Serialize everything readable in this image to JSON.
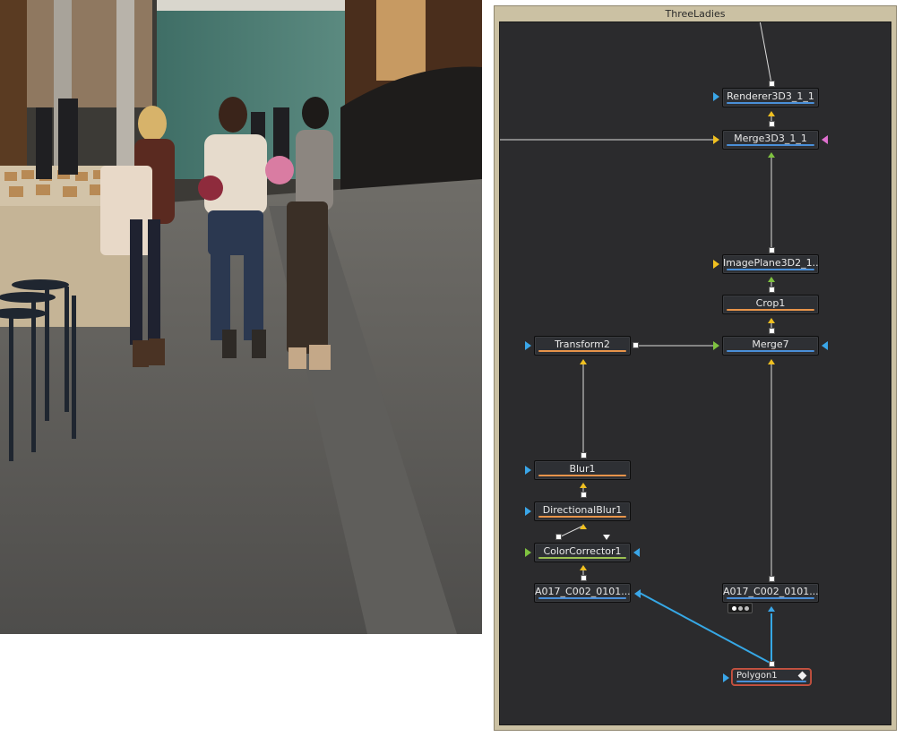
{
  "group": {
    "title": "ThreeLadies"
  },
  "nodes": {
    "renderer": "Renderer3D3_1_1",
    "merge3d": "Merge3D3_1_1",
    "imageplane": "ImagePlane3D2_1...",
    "crop": "Crop1",
    "merge7": "Merge7",
    "transform2": "Transform2",
    "blur1": "Blur1",
    "directionalblur": "DirectionalBlur1",
    "colorcorrector": "ColorCorrector1",
    "loader_left": "A017_C002_0101...",
    "loader_right": "A017_C002_0101...",
    "polygon": "Polygon1"
  },
  "colors": {
    "editor_background": "#2b2b2d",
    "group_frame": "#cbc1a3",
    "input_blue": "#3aa6e8",
    "input_yellow": "#f0c020",
    "input_green": "#7fc240",
    "mask_pink": "#e070d0",
    "mask_wire": "#36a8e6",
    "selected_outline": "#c85442"
  },
  "icons": {
    "background_input": "triangle-yellow",
    "foreground_input": "triangle-green",
    "effect_mask": "triangle-blue",
    "output": "square-white",
    "polygon_view": "diamond-icon",
    "loader_extras": "more-dots-icon"
  }
}
